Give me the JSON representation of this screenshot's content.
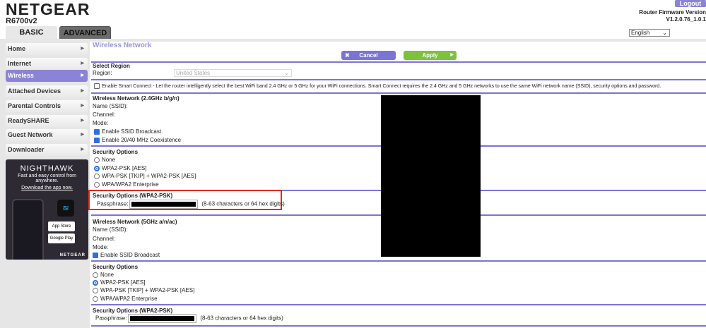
{
  "header": {
    "brand": "NETGEAR",
    "model": "R6700v2",
    "logout": "Logout",
    "fw_label": "Router Firmware Version",
    "fw_version": "V1.2.0.76_1.0.1",
    "language": "English"
  },
  "tabs": [
    {
      "label": "BASIC"
    },
    {
      "label": "ADVANCED"
    }
  ],
  "sidebar": {
    "items": [
      {
        "label": "Home"
      },
      {
        "label": "Internet"
      },
      {
        "label": "Wireless"
      },
      {
        "label": "Attached Devices"
      },
      {
        "label": "Parental Controls"
      },
      {
        "label": "ReadySHARE"
      },
      {
        "label": "Guest Network"
      },
      {
        "label": "Downloader"
      }
    ]
  },
  "ad": {
    "title": "NIGHTHAWK",
    "tagline": "Fast and easy control from anywhere.",
    "link": "Download the app now.",
    "app_store": "App Store",
    "google_play": "Google Play",
    "footer": "NETGEAR"
  },
  "page": {
    "title": "Wireless Network",
    "cancel": "Cancel",
    "apply": "Apply"
  },
  "region": {
    "heading": "Select Region",
    "label": "Region:",
    "value": "United States"
  },
  "smart_connect": "Enable Smart Connect - Let the router intelligently select the best WiFi band 2.4 GHz or 5 GHz for your WiFi connections. Smart Connect requires the 2.4 GHz and 5 GHz networks to use the same WiFi network name (SSID), security options and password.",
  "wifi24": {
    "heading": "Wireless Network (2.4GHz b/g/n)",
    "ssid": "Name (SSID):",
    "channel": "Channel:",
    "mode": "Mode:",
    "broadcast": "Enable SSID Broadcast",
    "coexist": "Enable 20/40 MHz Coexistence"
  },
  "security24": {
    "heading": "Security Options",
    "options": [
      "None",
      "WPA2-PSK [AES]",
      "WPA-PSK [TKIP] + WPA2-PSK [AES]",
      "WPA/WPA2 Enterprise"
    ]
  },
  "psk24": {
    "heading": "Security Options (WPA2-PSK)",
    "label": "Passphrase:",
    "hint": "(8-63 characters or 64 hex digits)"
  },
  "wifi5": {
    "heading": "Wireless Network (5GHz a/n/ac)",
    "ssid": "Name (SSID):",
    "channel": "Channel:",
    "mode": "Mode:",
    "broadcast": "Enable SSID Broadcast"
  },
  "security5": {
    "heading": "Security Options",
    "options": [
      "None",
      "WPA2-PSK [AES]",
      "WPA-PSK [TKIP] + WPA2-PSK [AES]",
      "WPA/WPA2 Enterprise"
    ]
  },
  "psk5": {
    "heading": "Security Options (WPA2-PSK)",
    "label": "Passphrase:",
    "hint": "(8-63 characters or 64 hex digits)"
  },
  "colors": {
    "accent": "#8a83d6",
    "divider": "#7b74d6",
    "apply": "#7cc23a",
    "highlight": "#e02b1f"
  }
}
